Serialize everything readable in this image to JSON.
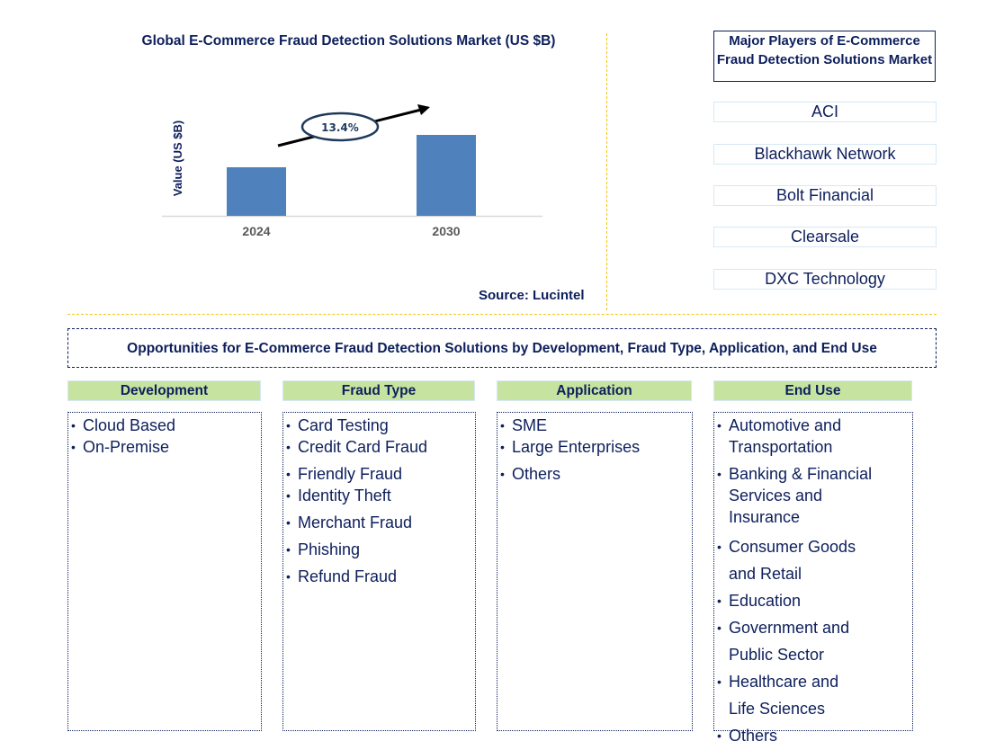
{
  "chart_data": {
    "type": "bar",
    "title": "Global E-Commerce Fraud Detection Solutions Market (US $B)",
    "xlabel": "",
    "ylabel": "Value (US $B)",
    "categories": [
      "2024",
      "2030"
    ],
    "values": [
      0.6,
      1.0
    ],
    "values_note": "relative bar heights; no axis scale shown",
    "bar_color": "#4f81bd",
    "grid": false,
    "annotation": {
      "text": "13.4%",
      "type": "CAGR arrow"
    },
    "source": "Source: Lucintel"
  },
  "players": {
    "title": "Major Players of E-Commerce Fraud Detection Solutions Market",
    "items": [
      "ACI",
      "Blackhawk Network",
      "Bolt Financial",
      "Clearsale",
      "DXC Technology"
    ]
  },
  "opportunities": {
    "title": "Opportunities for E-Commerce Fraud Detection Solutions by Development, Fraud Type, Application, and End Use",
    "categories": [
      {
        "name": "Development",
        "items": [
          "Cloud Based",
          "On-Premise"
        ]
      },
      {
        "name": "Fraud Type",
        "items": [
          "Card Testing",
          "Credit Card Fraud",
          "Friendly Fraud",
          "Identity Theft",
          "Merchant Fraud",
          "Phishing",
          "Refund Fraud"
        ]
      },
      {
        "name": "Application",
        "items": [
          "SME",
          "Large Enterprises",
          "Others"
        ]
      },
      {
        "name": "End Use",
        "items": [
          "Automotive and Transportation",
          "Banking & Financial Services and Insurance",
          "Consumer Goods and Retail",
          "Education",
          "Government and Public Sector",
          "Healthcare and Life Sciences",
          "Others"
        ]
      }
    ]
  },
  "colors": {
    "text_navy": "#0d1f5c",
    "bar_blue": "#4f81bd",
    "header_green": "#c6e3a0",
    "separator_gold": "#f5c518"
  }
}
